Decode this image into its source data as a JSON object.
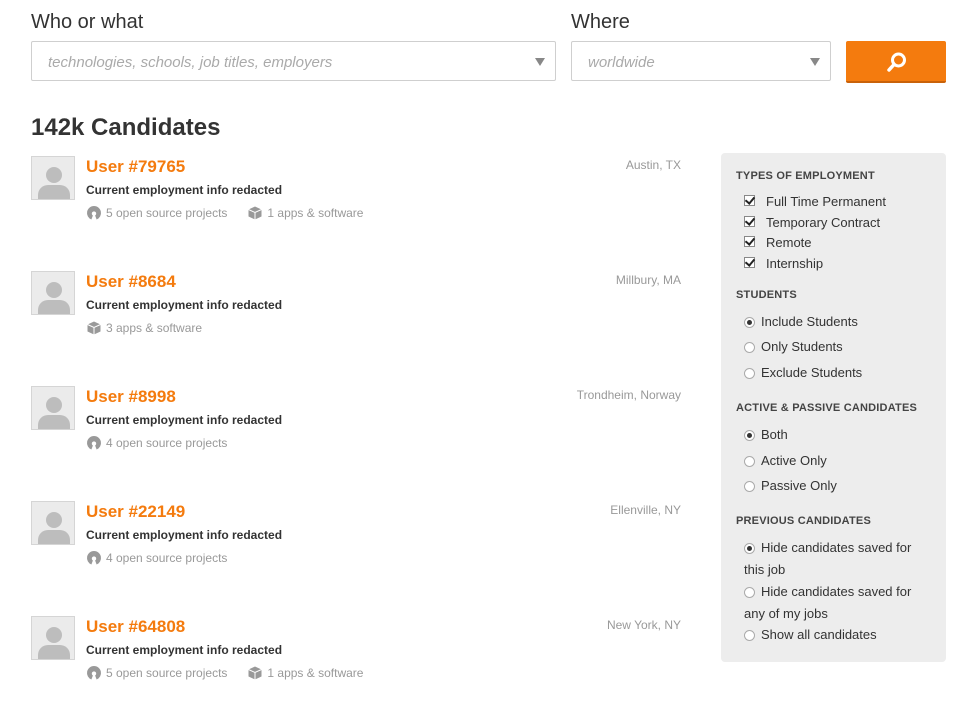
{
  "search": {
    "who_label": "Who or what",
    "who_placeholder": "technologies, schools, job titles, employers",
    "where_label": "Where",
    "where_placeholder": "worldwide",
    "search_button_icon": "search-icon"
  },
  "results": {
    "heading": "142k Candidates"
  },
  "candidates": [
    {
      "name": "User #79765",
      "employment": "Current employment info redacted",
      "location": "Austin, TX",
      "projects": "5 open source projects",
      "apps": "1 apps & software"
    },
    {
      "name": "User #8684",
      "employment": "Current employment info redacted",
      "location": "Millbury, MA",
      "apps": "3 apps & software"
    },
    {
      "name": "User #8998",
      "employment": "Current employment info redacted",
      "location": "Trondheim, Norway",
      "projects": "4 open source projects"
    },
    {
      "name": "User #22149",
      "employment": "Current employment info redacted",
      "location": "Ellenville, NY",
      "projects": "4 open source projects"
    },
    {
      "name": "User #64808",
      "employment": "Current employment info redacted",
      "location": "New York, NY",
      "projects": "5 open source projects",
      "apps": "1 apps & software"
    }
  ],
  "filters": {
    "employment": {
      "heading": "TYPES OF EMPLOYMENT",
      "options": [
        {
          "label": "Full Time Permanent",
          "checked": true
        },
        {
          "label": "Temporary Contract",
          "checked": true
        },
        {
          "label": "Remote",
          "checked": true
        },
        {
          "label": "Internship",
          "checked": true
        }
      ]
    },
    "students": {
      "heading": "STUDENTS",
      "options": [
        {
          "label": "Include Students",
          "selected": true
        },
        {
          "label": "Only Students",
          "selected": false
        },
        {
          "label": "Exclude Students",
          "selected": false
        }
      ]
    },
    "activity": {
      "heading": "ACTIVE & PASSIVE CANDIDATES",
      "options": [
        {
          "label": "Both",
          "selected": true
        },
        {
          "label": "Active Only",
          "selected": false
        },
        {
          "label": "Passive Only",
          "selected": false
        }
      ]
    },
    "previous": {
      "heading": "PREVIOUS CANDIDATES",
      "options": [
        {
          "label": "Hide candidates saved for this job",
          "selected": true
        },
        {
          "label": "Hide candidates saved for any of my jobs",
          "selected": false
        },
        {
          "label": "Show all candidates",
          "selected": false
        }
      ]
    }
  },
  "colors": {
    "accent": "#f47b0e",
    "panel_bg": "#ededed"
  }
}
